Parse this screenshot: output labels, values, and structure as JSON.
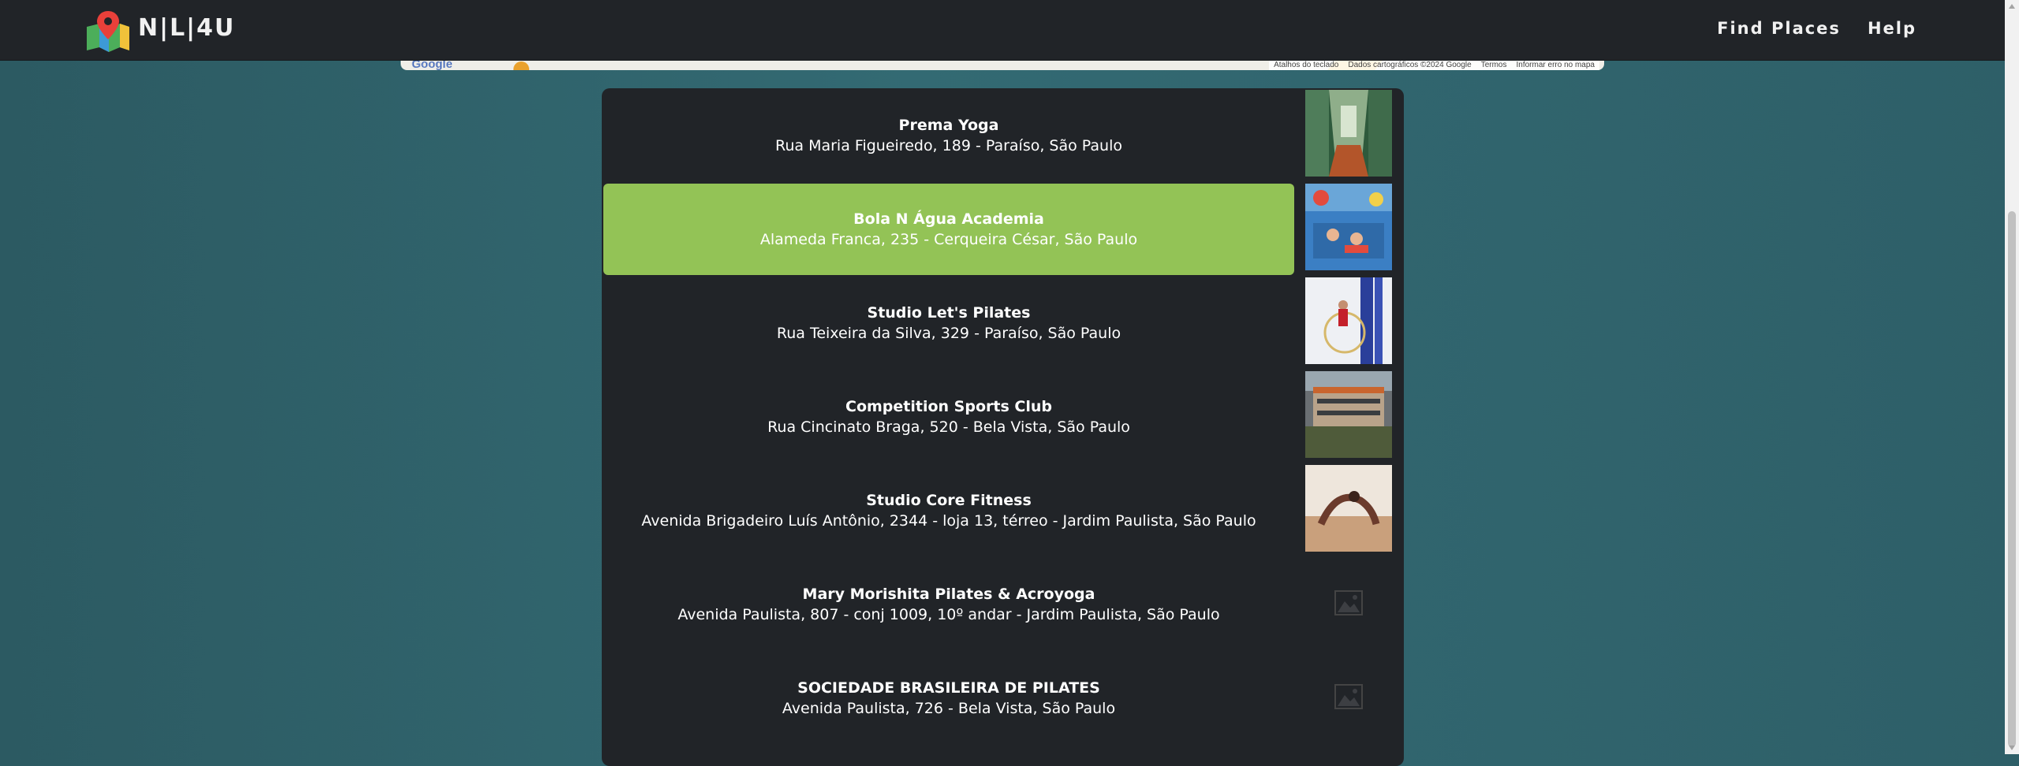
{
  "header": {
    "brand": "N|L|4U",
    "nav": [
      "Find Places",
      "Help"
    ]
  },
  "map": {
    "logo_text": "Google",
    "footer": [
      "Atalhos do teclado",
      "Dados cartográficos ©2024 Google",
      "Termos",
      "Informar erro no mapa"
    ]
  },
  "places": [
    {
      "name": "Prema Yoga",
      "address": "Rua Maria Figueiredo, 189 - Paraíso, São Paulo",
      "image": "yoga-studio-photo",
      "active": false
    },
    {
      "name": "Bola N Água Academia",
      "address": "Alameda Franca, 235 - Cerqueira César, São Paulo",
      "image": "swimming-pool-photo",
      "active": true
    },
    {
      "name": "Studio Let's Pilates",
      "address": "Rua Teixeira da Silva, 329 - Paraíso, São Paulo",
      "image": "pilates-aerial-photo",
      "active": false
    },
    {
      "name": "Competition Sports Club",
      "address": "Rua Cincinato Braga, 520 - Bela Vista, São Paulo",
      "image": "sports-building-photo",
      "active": false
    },
    {
      "name": "Studio Core Fitness",
      "address": "Avenida Brigadeiro Luís Antônio, 2344 - loja 13, térreo - Jardim Paulista, São Paulo",
      "image": "fitness-pose-photo",
      "active": false
    },
    {
      "name": "Mary Morishita Pilates & Acroyoga",
      "address": "Avenida Paulista, 807 - conj 1009, 10º andar - Jardim Paulista, São Paulo",
      "image": "image-placeholder-icon",
      "active": false
    },
    {
      "name": "SOCIEDADE BRASILEIRA DE PILATES",
      "address": "Avenida Paulista, 726 - Bela Vista, São Paulo",
      "image": "image-placeholder-icon",
      "active": false
    }
  ],
  "colors": {
    "header_bg": "#212428",
    "panel_bg": "#212428",
    "active_row": "#93c356",
    "page_bg": "#336a73"
  }
}
